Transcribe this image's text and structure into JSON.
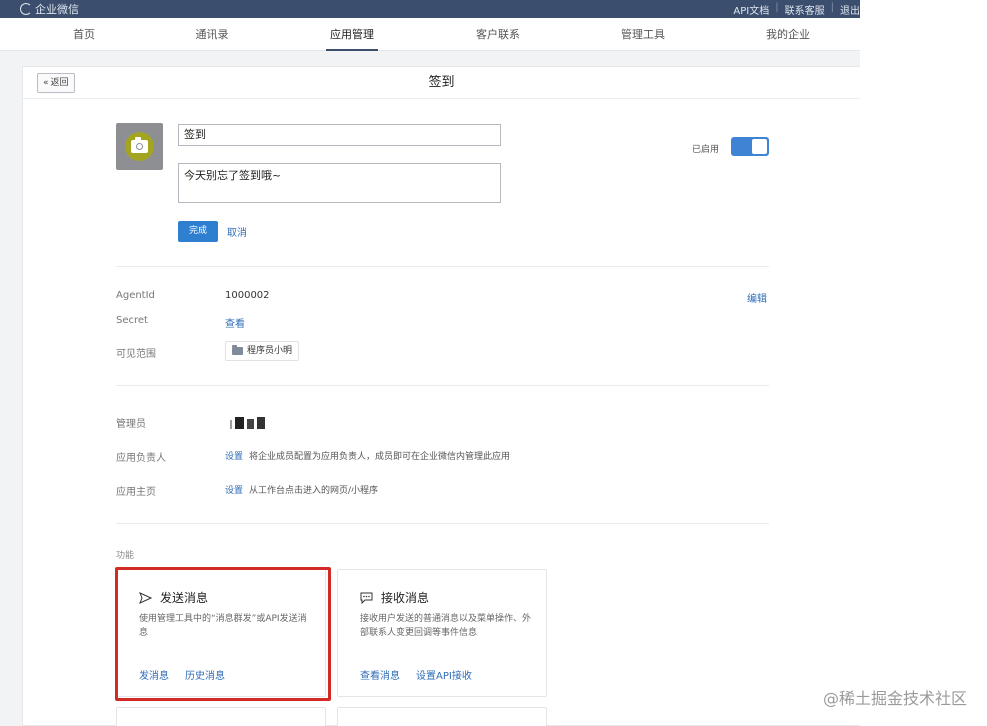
{
  "topbar": {
    "logo_text": "企业微信",
    "links": [
      "API文档",
      "联系客服",
      "退出"
    ],
    "separator": "|"
  },
  "nav": {
    "items": [
      "首页",
      "通讯录",
      "应用管理",
      "客户联系",
      "管理工具",
      "我的企业"
    ],
    "active_index": 2
  },
  "page": {
    "back_label": "返回",
    "title": "签到"
  },
  "app": {
    "name_value": "签到",
    "description_value": "今天别忘了签到哦~",
    "done_label": "完成",
    "cancel_label": "取消",
    "enabled_label": "已启用",
    "enabled": true,
    "edit_label": "编辑"
  },
  "details": {
    "agentid_label": "AgentId",
    "agentid_value": "1000002",
    "secret_label": "Secret",
    "secret_link": "查看",
    "visible_label": "可见范围",
    "visible_chip": "程序员小明"
  },
  "admin": {
    "admin_label": "管理员",
    "owner_label": "应用负责人",
    "owner_link": "设置",
    "owner_hint": "将企业成员配置为应用负责人，成员即可在企业微信内管理此应用",
    "home_label": "应用主页",
    "home_link": "设置",
    "home_hint": "从工作台点击进入的网页/小程序"
  },
  "features": {
    "section_label": "功能",
    "cards": [
      {
        "title": "发送消息",
        "description": "使用管理工具中的“消息群发”或API发送消息",
        "actions": [
          "发消息",
          "历史消息"
        ]
      },
      {
        "title": "接收消息",
        "description": "接收用户发送的普通消息以及菜单操作、外部联系人变更回调等事件信息",
        "actions": [
          "查看消息",
          "设置API接收"
        ]
      }
    ]
  },
  "colors": {
    "topbar": "#3b4e6e",
    "primary": "#2f7fd0",
    "link": "#2f6db8",
    "highlight": "#d22a25"
  },
  "watermark": "@稀土掘金技术社区"
}
